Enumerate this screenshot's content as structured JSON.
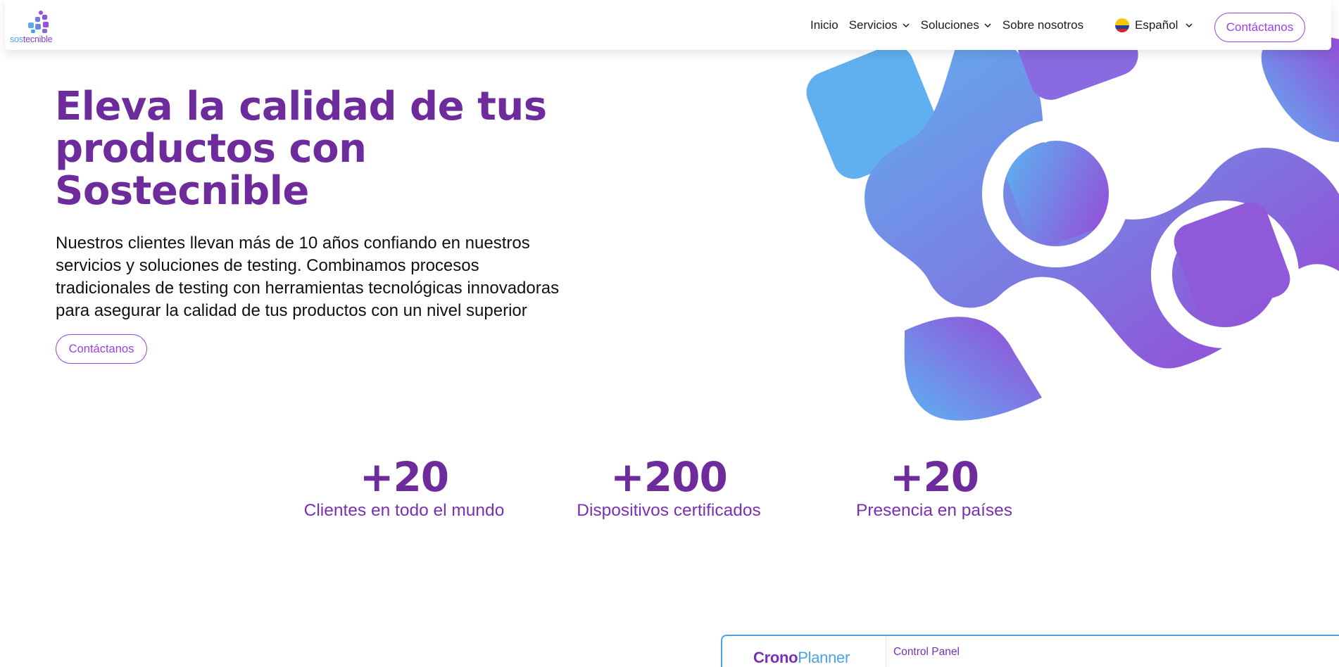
{
  "brand": {
    "logo_part1": "sos",
    "logo_part2": "tecnible",
    "colors": {
      "primary_purple": "#6e2b9c",
      "accent_violet": "#9b40e0",
      "accent_blue": "#4aa3ea"
    }
  },
  "nav": {
    "items": [
      {
        "label": "Inicio",
        "has_dropdown": false
      },
      {
        "label": "Servicios",
        "has_dropdown": true
      },
      {
        "label": "Soluciones",
        "has_dropdown": true
      },
      {
        "label": "Sobre nosotros",
        "has_dropdown": false
      }
    ],
    "language": {
      "label": "Español",
      "flag_icon": "colombia-flag-icon",
      "dropdown_icon": "chevron-down-icon"
    },
    "cta_label": "Contáctanos"
  },
  "hero": {
    "title_lines": [
      "Eleva la calidad de tus",
      "productos con",
      "Sostecnible"
    ],
    "description_lines": [
      "Nuestros clientes llevan más de 10 años confiando en nuestros",
      "servicios y soluciones de testing. Combinamos procesos",
      "tradicionales de testing con herramientas tecnológicas innovadoras",
      "para asegurar la calidad de tus productos con un nivel superior"
    ],
    "cta_label": "Contáctanos"
  },
  "stats": [
    {
      "value": "+20",
      "label": "Clientes en todo el mundo"
    },
    {
      "value": "+200",
      "label": "Dispositivos certificados"
    },
    {
      "value": "+20",
      "label": "Presencia en países"
    }
  ],
  "preview": {
    "logo_part1": "Crono",
    "logo_part2": "Planner",
    "panel_title": "Control Panel"
  }
}
